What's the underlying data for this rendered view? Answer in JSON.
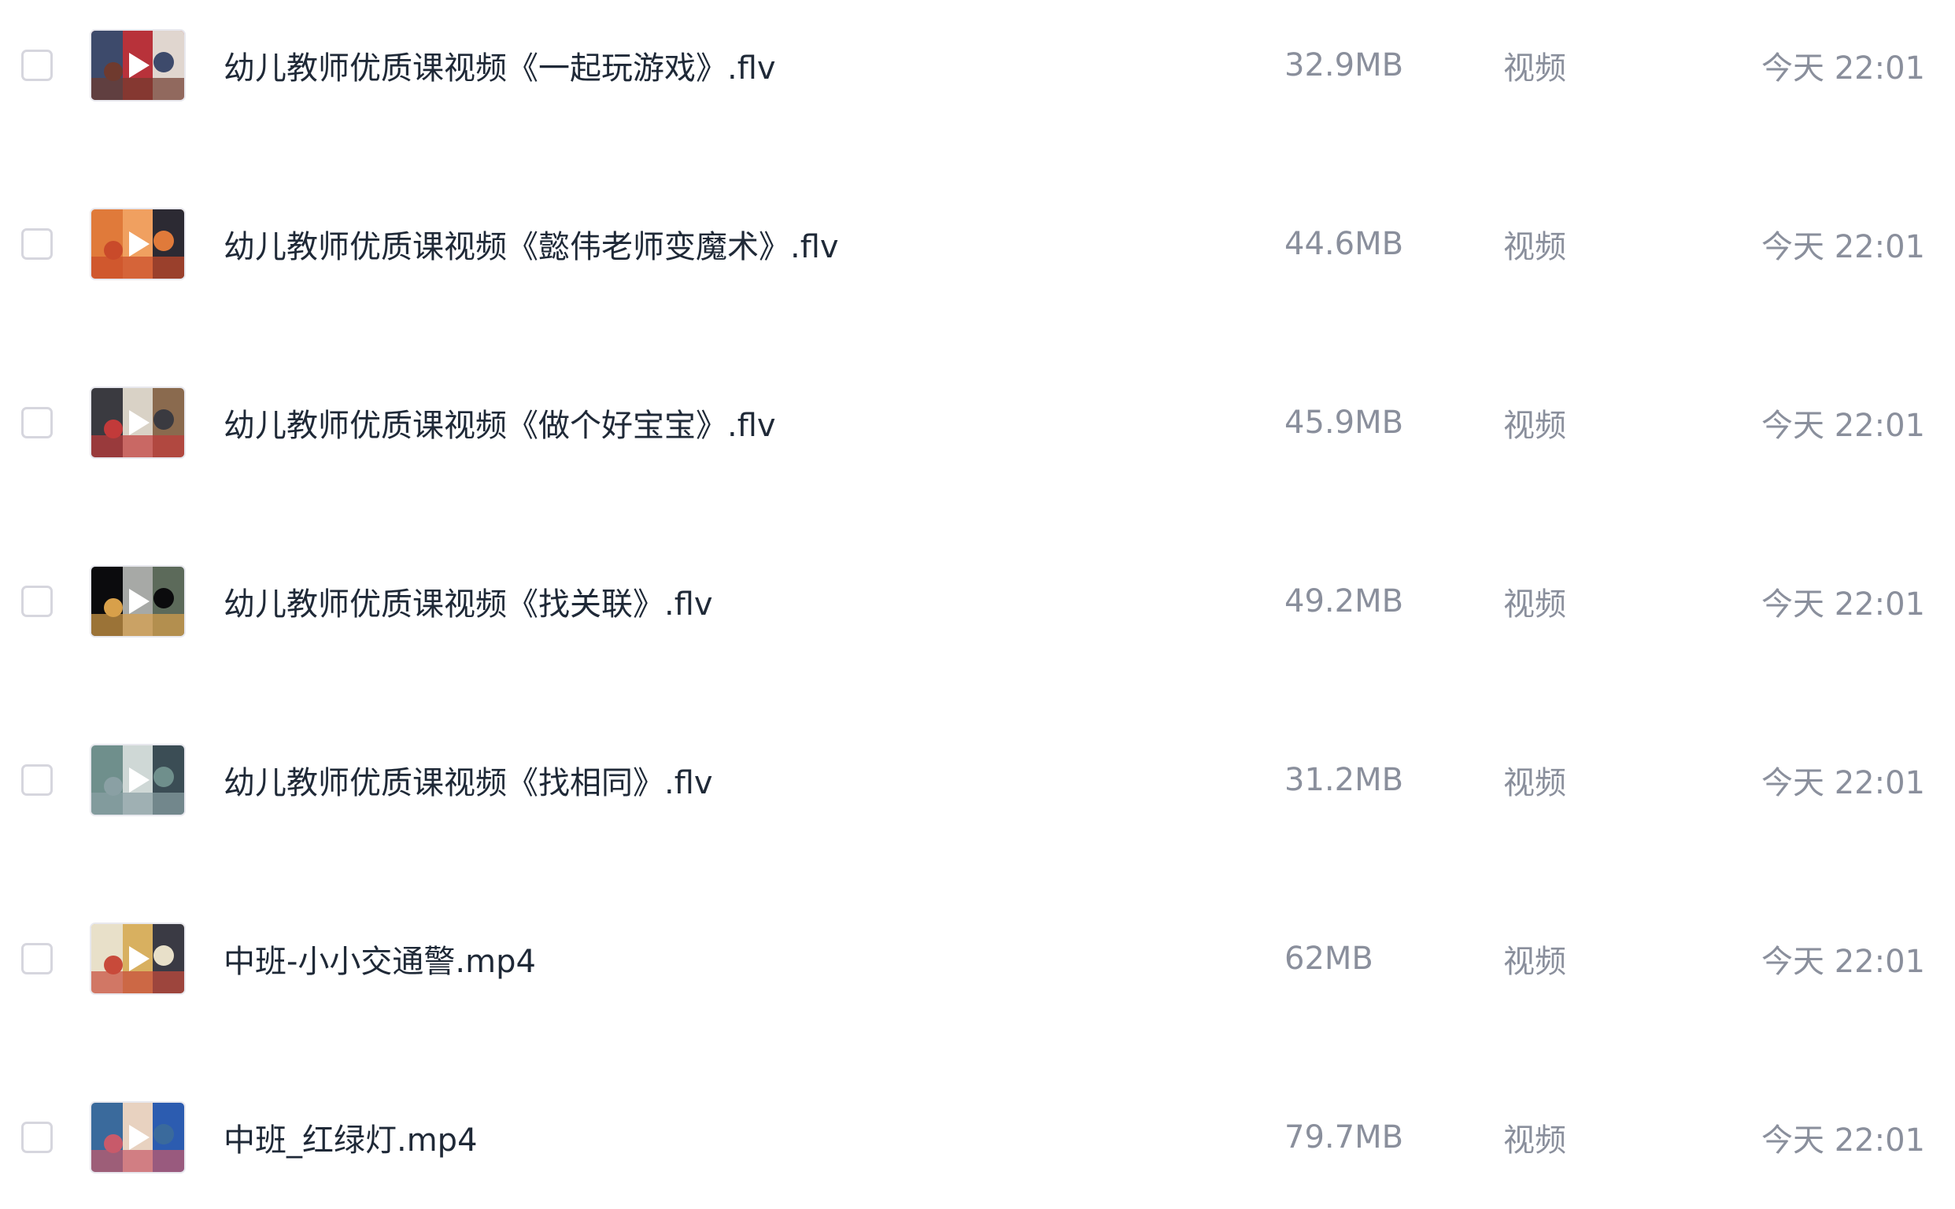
{
  "colors": {
    "name_text": "#1f2937",
    "meta_text": "#8a8f9c",
    "checkbox_border": "#d6d6de",
    "background": "#ffffff"
  },
  "file_list": {
    "items": [
      {
        "name": "幼儿教师优质课视频《一起玩游戏》.flv",
        "size": "32.9MB",
        "type": "视频",
        "modified": "今天 22:01",
        "thumbnail_icon": "video-play-icon",
        "thumb_colors": [
          "#3d4a6b",
          "#b8323a",
          "#e0d6cf",
          "#6f3a2e"
        ]
      },
      {
        "name": "幼儿教师优质课视频《懿伟老师变魔术》.flv",
        "size": "44.6MB",
        "type": "视频",
        "modified": "今天 22:01",
        "thumbnail_icon": "video-play-icon",
        "thumb_colors": [
          "#e07a3a",
          "#f0a060",
          "#2c2a33",
          "#c94a2a"
        ]
      },
      {
        "name": "幼儿教师优质课视频《做个好宝宝》.flv",
        "size": "45.9MB",
        "type": "视频",
        "modified": "今天 22:01",
        "thumbnail_icon": "video-play-icon",
        "thumb_colors": [
          "#3a3a40",
          "#d9d2c6",
          "#8a6a4e",
          "#c23a3a"
        ]
      },
      {
        "name": "幼儿教师优质课视频《找关联》.flv",
        "size": "49.2MB",
        "type": "视频",
        "modified": "今天 22:01",
        "thumbnail_icon": "video-play-icon",
        "thumb_colors": [
          "#0b0b0d",
          "#a7a9a6",
          "#5c6a5a",
          "#d8a04a"
        ]
      },
      {
        "name": "幼儿教师优质课视频《找相同》.flv",
        "size": "31.2MB",
        "type": "视频",
        "modified": "今天 22:01",
        "thumbnail_icon": "video-play-icon",
        "thumb_colors": [
          "#6f8f8c",
          "#cfd8d6",
          "#3b4d55",
          "#8aa0a4"
        ]
      },
      {
        "name": "中班-小小交通警.mp4",
        "size": "62MB",
        "type": "视频",
        "modified": "今天 22:01",
        "thumbnail_icon": "video-play-icon",
        "thumb_colors": [
          "#e8e0c9",
          "#d8b060",
          "#3a3a44",
          "#c84a3a"
        ]
      },
      {
        "name": "中班_红绿灯.mp4",
        "size": "79.7MB",
        "type": "视频",
        "modified": "今天 22:01",
        "thumbnail_icon": "video-play-icon",
        "thumb_colors": [
          "#3a6a9c",
          "#e8d2c0",
          "#2c5cb0",
          "#c85a6a"
        ]
      }
    ]
  }
}
